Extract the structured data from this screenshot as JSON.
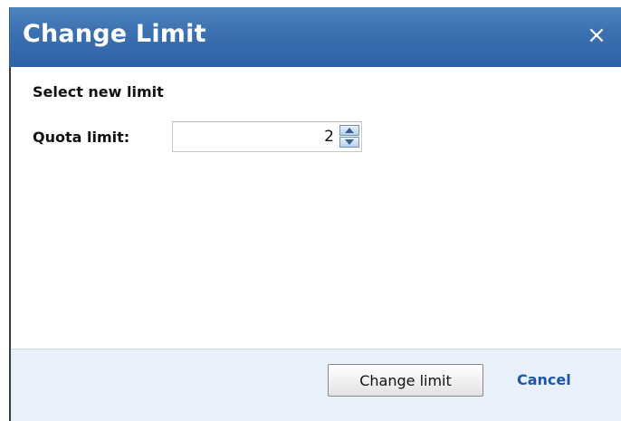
{
  "dialog": {
    "title": "Change Limit",
    "close_glyph": "×"
  },
  "form": {
    "section_label": "Select new limit",
    "quota_label": "Quota limit:",
    "quota_value": "2"
  },
  "footer": {
    "primary_label": "Change limit",
    "cancel_label": "Cancel"
  },
  "colors": {
    "titlebar": "#3a6fb0",
    "footer_bg": "#e8f0fb",
    "link": "#1f55a8"
  },
  "icons": [
    "close-icon",
    "spinner-up-icon",
    "spinner-down-icon"
  ]
}
